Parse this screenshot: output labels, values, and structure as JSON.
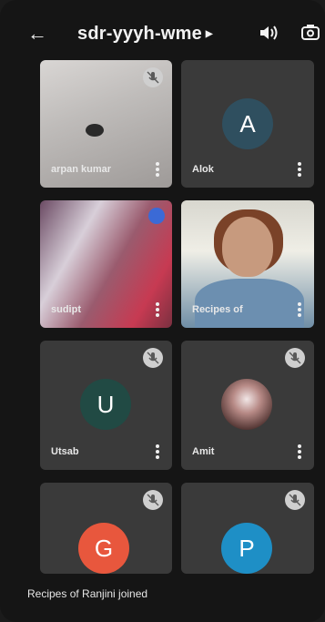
{
  "header": {
    "back_icon": "arrow-left-icon",
    "meeting_code": "sdr-yyyh-wme",
    "dropdown_icon": "caret-right-icon",
    "speaker_icon": "speaker-icon",
    "switch_camera_icon": "camera-switch-icon"
  },
  "participants": [
    {
      "name": "arpan kumar",
      "type": "video",
      "muted": true
    },
    {
      "name": "Alok",
      "type": "avatar",
      "initial": "A",
      "color": "#2f4f5f",
      "muted": false
    },
    {
      "name": "sudipt",
      "type": "video",
      "muted": false
    },
    {
      "name": "Recipes of",
      "type": "video",
      "muted": false
    },
    {
      "name": "Utsab",
      "type": "avatar",
      "initial": "U",
      "color": "#214a44",
      "muted": true
    },
    {
      "name": "Amit",
      "type": "photo",
      "muted": true
    },
    {
      "name": "",
      "type": "avatar",
      "initial": "G",
      "color": "#e8573d",
      "muted": true
    },
    {
      "name": "",
      "type": "avatar",
      "initial": "P",
      "color": "#1e8fc6",
      "muted": true
    }
  ],
  "toast": "Recipes of Ranjini joined"
}
